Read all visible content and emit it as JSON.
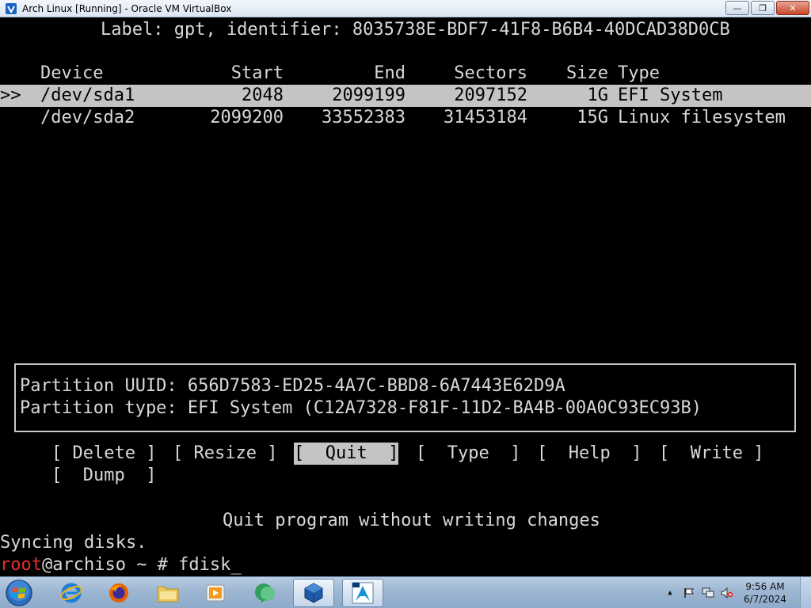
{
  "window": {
    "title": "Arch Linux [Running] - Oracle VM VirtualBox",
    "minimize_label": "—",
    "maximize_label": "❐",
    "close_label": "✕"
  },
  "terminal": {
    "label_line": "Label: gpt, identifier: 8035738E-BDF7-41F8-B6B4-40DCAD38D0CB",
    "columns": {
      "device": "Device",
      "start": "Start",
      "end": "End",
      "sectors": "Sectors",
      "size": "Size",
      "type": "Type"
    },
    "rows": [
      {
        "selector": ">>",
        "device": "/dev/sda1",
        "start": "2048",
        "end": "2099199",
        "sectors": "2097152",
        "size": "1G",
        "type": "EFI System"
      },
      {
        "selector": "",
        "device": "/dev/sda2",
        "start": "2099200",
        "end": "33552383",
        "sectors": "31453184",
        "size": "15G",
        "type": "Linux filesystem"
      }
    ],
    "info": {
      "uuid_line": "Partition UUID: 656D7583-ED25-4A7C-BBD8-6A7443E62D9A",
      "type_line": "Partition type: EFI System (C12A7328-F81F-11D2-BA4B-00A0C93EC93B)"
    },
    "menu": [
      {
        "label": "[ Delete ]"
      },
      {
        "label": "[ Resize ]"
      },
      {
        "label": "[  Quit  ]"
      },
      {
        "label": "[  Type  ]"
      },
      {
        "label": "[  Help  ]"
      },
      {
        "label": "[  Write ]"
      },
      {
        "label": "[  Dump  ]"
      }
    ],
    "selected_menu": "Quit",
    "hint": "Quit program without writing changes",
    "sync_line": "Syncing disks.",
    "prompt_user": "root",
    "prompt_rest": "@archiso ~ # fdisk_"
  },
  "taskbar": {
    "apps": [
      "start-orb",
      "internet-explorer",
      "firefox",
      "file-explorer",
      "media-player",
      "chat-app",
      "virtualbox",
      "arch-linux-vm"
    ],
    "clock_time": "9:56 AM",
    "clock_date": "6/7/2024",
    "tray_up_arrow": "▲"
  }
}
